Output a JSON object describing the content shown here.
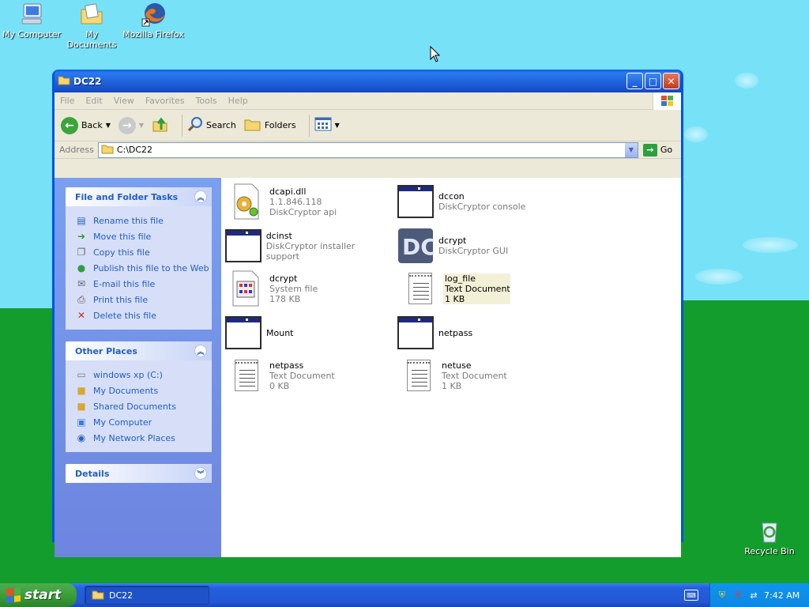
{
  "desktop": {
    "icons": [
      {
        "label": "My Computer"
      },
      {
        "label": "My Documents"
      },
      {
        "label": "Mozilla Firefox"
      },
      {
        "label": "Recycle Bin"
      }
    ]
  },
  "window": {
    "title": "DC22",
    "menu": [
      "File",
      "Edit",
      "View",
      "Favorites",
      "Tools",
      "Help"
    ],
    "toolbar": {
      "back": "Back",
      "search": "Search",
      "folders": "Folders"
    },
    "address": {
      "label": "Address",
      "value": "C:\\DC22",
      "go": "Go"
    },
    "tasks_panel": {
      "title": "File and Folder Tasks",
      "items": [
        "Rename this file",
        "Move this file",
        "Copy this file",
        "Publish this file to the Web",
        "E-mail this file",
        "Print this file",
        "Delete this file"
      ]
    },
    "places_panel": {
      "title": "Other Places",
      "items": [
        "windows xp (C:)",
        "My Documents",
        "Shared Documents",
        "My Computer",
        "My Network Places"
      ]
    },
    "details_panel": {
      "title": "Details"
    },
    "files": [
      {
        "name": "dcapi.dll",
        "line2": "1.1.846.118",
        "line3": "DiskCryptor api",
        "icon": "dll-icon"
      },
      {
        "name": "dccon",
        "line2": "DiskCryptor console",
        "line3": "",
        "icon": "app-window-icon"
      },
      {
        "name": "dcinst",
        "line2": "DiskCryptor installer support",
        "line3": "",
        "icon": "app-window-icon"
      },
      {
        "name": "dcrypt",
        "line2": "DiskCryptor GUI",
        "line3": "",
        "icon": "diskcryptor-icon"
      },
      {
        "name": "dcrypt",
        "line2": "System file",
        "line3": "178 KB",
        "icon": "system-file-icon"
      },
      {
        "name": "log_file",
        "line2": "Text Document",
        "line3": "1 KB",
        "icon": "text-document-icon"
      },
      {
        "name": "Mount",
        "line2": "",
        "line3": "",
        "icon": "app-window-icon"
      },
      {
        "name": "netpass",
        "line2": "",
        "line3": "",
        "icon": "app-window-icon"
      },
      {
        "name": "netpass",
        "line2": "Text Document",
        "line3": "0 KB",
        "icon": "text-document-icon"
      },
      {
        "name": "netuse",
        "line2": "Text Document",
        "line3": "1 KB",
        "icon": "text-document-icon"
      }
    ]
  },
  "taskbar": {
    "start": "start",
    "task": "DC22",
    "clock": "7:42 AM"
  },
  "colors": {
    "link_blue": "#215dc6",
    "title_blue": "#0054e3",
    "start_green": "#379a37"
  }
}
